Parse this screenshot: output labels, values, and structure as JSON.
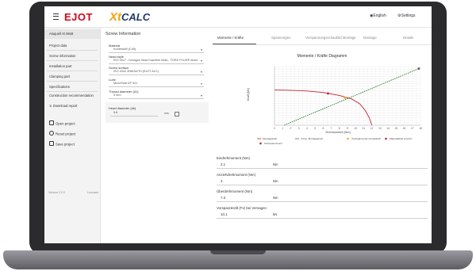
{
  "brand": {
    "company": "EJOT",
    "product_xt": "Xt",
    "product_calc": "CALC"
  },
  "header": {
    "language_label": "English",
    "settings_label": "Settings"
  },
  "sidebar": {
    "project": "Aluquell XI 98x8",
    "items": [
      {
        "label": "Project data"
      },
      {
        "label": "Screw information"
      },
      {
        "label": "Installation part"
      },
      {
        "label": "Clamping part"
      },
      {
        "label": "Specifications"
      },
      {
        "label": "Construction recommendation"
      },
      {
        "label": "Download report"
      }
    ],
    "actions": [
      {
        "label": "Open project"
      },
      {
        "label": "Reset project"
      },
      {
        "label": "Save project"
      }
    ],
    "version": "Version 2.2.0",
    "license": "Licenses"
  },
  "form": {
    "title": "Screw Information",
    "fields": [
      {
        "label": "Material",
        "value": "Kohlestahl (C45)"
      },
      {
        "label": "Head style",
        "value": "ISO 4017 - hexagon head machine head - TORX PLUS® recess"
      },
      {
        "label": "Screw surface",
        "value": "ISO 4042 ZN8/An/T0 (EJOT ALC)"
      },
      {
        "label": "Lube",
        "value": "MicroSeal DF 921"
      },
      {
        "label": "Thread diameter (d1)",
        "value": "5 mm"
      }
    ],
    "head_diameter": {
      "label": "Head diameter (dk)",
      "value": "9.8",
      "unit": "mm"
    }
  },
  "tabs": [
    {
      "label": "Momente / Kräfte"
    },
    {
      "label": "Spannungen"
    },
    {
      "label": "Verspannungsschaubild Montage"
    },
    {
      "label": "Montage"
    },
    {
      "label": "Details"
    }
  ],
  "chart_data": {
    "type": "line",
    "title": "Momente / Kräfte Diagramm",
    "xlabel": "Drehmoment [Nm]",
    "ylabel": "Kraft [kN]",
    "x_ticks": [
      "0",
      "1",
      "2",
      "3",
      "4",
      "5",
      "6",
      "7",
      "8",
      "9",
      "10",
      "11",
      "12",
      "13",
      "14",
      "15",
      "16",
      "17",
      "18"
    ],
    "xlim": [
      0,
      18
    ],
    "ylim": [
      0,
      12
    ],
    "grid": true,
    "legend_position": "bottom",
    "series": [
      {
        "name": "Montagekraft",
        "color": "#c8202d",
        "style": "solid",
        "points": [
          [
            0,
            7.2
          ],
          [
            2,
            7.15
          ],
          [
            4,
            7.0
          ],
          [
            6,
            6.7
          ],
          [
            8,
            6.1
          ],
          [
            9.5,
            5.4
          ],
          [
            10.5,
            4.4
          ],
          [
            11.2,
            3.0
          ],
          [
            11.7,
            1.5
          ],
          [
            12,
            0
          ]
        ]
      },
      {
        "name": "Vorsp. Montagekraft",
        "color": "#2f7d32",
        "style": "dashed",
        "points": [
          [
            1.2,
            0
          ],
          [
            17.8,
            11.6
          ]
        ]
      }
    ],
    "markers": [
      {
        "name": "Vorbeginnende Anstellkraft",
        "color": "#f2b01e",
        "x": 8.7,
        "y": 5.6
      },
      {
        "name": "Materialkraft erreicht",
        "color": "#c8202d",
        "x": 6.6,
        "y": 6.5
      },
      {
        "name": "Schraubenbruch",
        "color": "#555555",
        "x": 17.8,
        "y": 11.6
      }
    ],
    "legend": [
      {
        "label": "Montagekraft",
        "color": "#c8202d",
        "kind": "line"
      },
      {
        "label": "Vorsp. Montagekraft",
        "color": "#2f7d32",
        "kind": "line"
      },
      {
        "label": "Vorbeginnende Anstellkraft",
        "color": "#f2b01e",
        "kind": "dot"
      },
      {
        "label": "Materialkraft erreicht",
        "color": "#c8202d",
        "kind": "dot"
      },
      {
        "label": "Schraubenbruch",
        "color": "#c8202d",
        "kind": "dot"
      }
    ]
  },
  "results": [
    {
      "label": "Eindrehmoment (Nm)",
      "value": "2.1",
      "unit": "Nm"
    },
    {
      "label": "Anziehdrehmoment (Nm)",
      "value": "3",
      "unit": "Nm"
    },
    {
      "label": "Überdrehmoment (Nm)",
      "value": "7.3",
      "unit": "Nm"
    },
    {
      "label": "Vorspannkraft (Fv) bei Versagen",
      "value": "10.1",
      "unit": "kN"
    }
  ]
}
